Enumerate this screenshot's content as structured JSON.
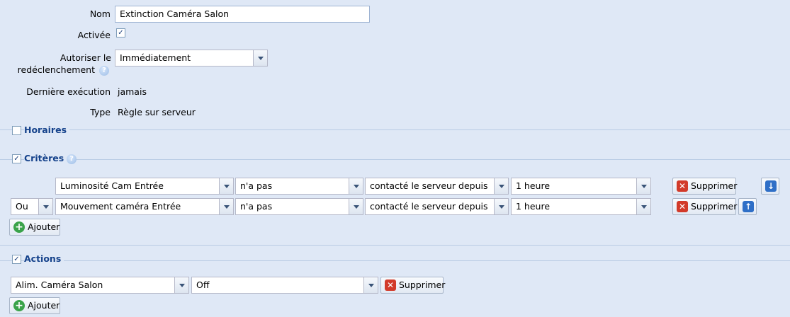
{
  "general": {
    "name_label": "Nom",
    "name_value": "Extinction Caméra Salon",
    "enabled_label": "Activée",
    "enabled_checked": true,
    "retrigger_label_line1": "Autoriser le",
    "retrigger_label_line2": "redéclenchement",
    "retrigger_value": "Immédiatement",
    "last_exec_label": "Dernière exécution",
    "last_exec_value": "jamais",
    "type_label": "Type",
    "type_value": "Règle sur serveur"
  },
  "schedules": {
    "title": "Horaires",
    "checked": false
  },
  "criteria": {
    "title": "Critères",
    "checked": true,
    "rows": [
      {
        "conjunction": "",
        "device": "Luminosité Cam Entrée",
        "operator": "n'a pas",
        "condition": "contacté le serveur depuis",
        "duration": "1 heure",
        "delete_label": "Supprimer",
        "move_icon": "arrow-down-icon"
      },
      {
        "conjunction": "Ou",
        "device": "Mouvement caméra Entrée",
        "operator": "n'a pas",
        "condition": "contacté le serveur depuis",
        "duration": "1 heure",
        "delete_label": "Supprimer",
        "move_icon": "arrow-up-icon"
      }
    ],
    "add_label": "Ajouter"
  },
  "actions": {
    "title": "Actions",
    "checked": true,
    "rows": [
      {
        "device": "Alim. Caméra Salon",
        "value": "Off",
        "delete_label": "Supprimer"
      }
    ],
    "add_label": "Ajouter"
  },
  "colors": {
    "background": "#dfe8f6",
    "section_title": "#15428b",
    "delete_icon": "#d23a2a",
    "add_icon": "#3aa34a",
    "arrow_icon": "#2f6fc7"
  }
}
